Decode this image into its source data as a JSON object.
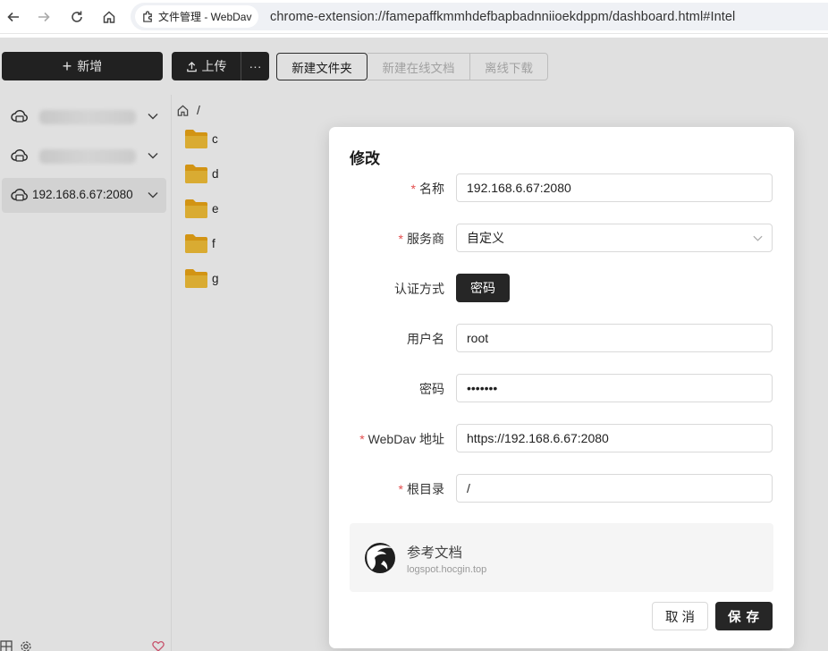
{
  "browser": {
    "tab_title": "文件管理 - WebDav",
    "url": "chrome-extension://famepaffkmmhdefbapbadnniioekdppm/dashboard.html#Intel"
  },
  "toolbar": {
    "new_label": "新增",
    "upload_label": "上传",
    "more_label": "···",
    "new_folder_label": "新建文件夹",
    "new_online_doc_label": "新建在线文档",
    "offline_download_label": "离线下载"
  },
  "sidebar": {
    "items": [
      {
        "label": ""
      },
      {
        "label": ""
      },
      {
        "label": "192.168.6.67:2080"
      }
    ]
  },
  "main": {
    "breadcrumb": "/",
    "folders": [
      {
        "name": "c"
      },
      {
        "name": "d"
      },
      {
        "name": "e"
      },
      {
        "name": "f"
      },
      {
        "name": "g"
      }
    ]
  },
  "dialog": {
    "title": "修改",
    "required_mark": "*",
    "fields": {
      "name": {
        "label": "名称",
        "value": "192.168.6.67:2080"
      },
      "provider": {
        "label": "服务商",
        "value": "自定义"
      },
      "auth": {
        "label": "认证方式",
        "value": "密码"
      },
      "username": {
        "label": "用户名",
        "value": "root"
      },
      "password": {
        "label": "密码",
        "value": "•••••••"
      },
      "webdav": {
        "label": "WebDav 地址",
        "value": "https://192.168.6.67:2080"
      },
      "root": {
        "label": "根目录",
        "value": "/"
      }
    },
    "doc": {
      "title": "参考文档",
      "url": "logspot.hocgin.top"
    },
    "cancel_label": "取 消",
    "save_label": "保 存"
  },
  "colors": {
    "accent_dark": "#262626",
    "required": "#e34d4d",
    "folder": "#f5b829"
  }
}
